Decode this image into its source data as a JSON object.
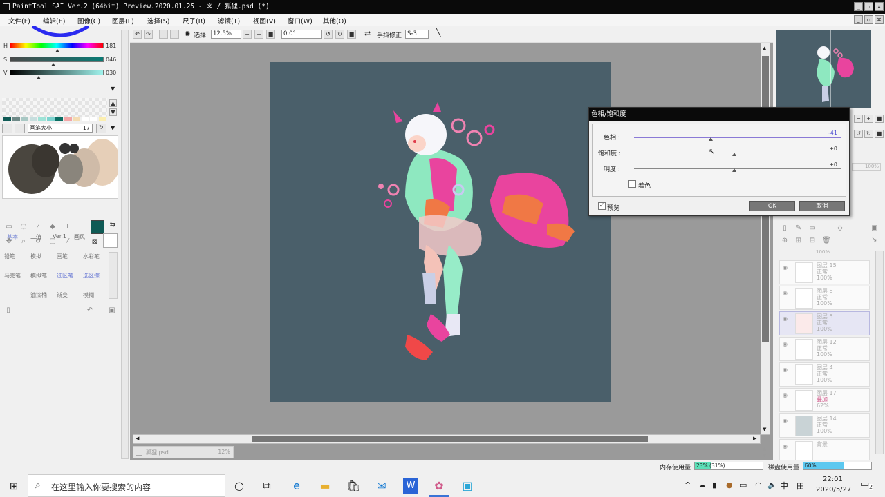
{
  "window": {
    "title": "PaintTool SAI Ver.2 (64bit) Preview.2020.01.25 - 図 / 狐狸.psd (*)",
    "controls": [
      "_",
      "▫",
      "✕"
    ]
  },
  "menu": [
    "文件(F)",
    "编辑(E)",
    "图像(C)",
    "图层(L)",
    "选择(S)",
    "尺子(R)",
    "滤镜(T)",
    "视图(V)",
    "窗口(W)",
    "其他(O)"
  ],
  "color_panel": {
    "h_label": "H",
    "h_value": "181",
    "s_label": "S",
    "s_value": "046",
    "v_label": "V",
    "v_value": "030",
    "swatches": [
      "#0f5a55",
      "#6f8a88",
      "#a9c8c4",
      "#c7dede",
      "#9fe3d7",
      "#7dd3cf",
      "#0c6d62",
      "#f2a6a6",
      "#f4dcb2",
      "#ffffff",
      "#ffffff",
      "#fbeeb0"
    ]
  },
  "brush_panel": {
    "size_label": "画笔大小",
    "size_value": "17",
    "tabs": [
      "基本",
      "二值",
      "Ver.1",
      "画风"
    ],
    "brushes": [
      "铅笔",
      "模拟",
      "画笔",
      "水彩笔",
      "马克笔",
      "模拟笔",
      "选区笔",
      "选区擦",
      "油漆桶",
      "渐变",
      "模糊"
    ],
    "primary_color": "#0f5a55"
  },
  "toolbar": {
    "select_label": "选择",
    "zoom": "12.5%",
    "angle": "0.0°",
    "stabilizer_label": "手抖修正",
    "stabilizer_value": "S-3"
  },
  "doc_tab": {
    "name": "狐狸.psd",
    "zoom": "12%"
  },
  "layers": [
    {
      "name": "图层 15",
      "mode": "正常",
      "opacity": "100%"
    },
    {
      "name": "图层 8",
      "mode": "正常",
      "opacity": "100%"
    },
    {
      "name": "图层 5",
      "mode": "正常",
      "opacity": "100%"
    },
    {
      "name": "图层 12",
      "mode": "正常",
      "opacity": "100%"
    },
    {
      "name": "图层 4",
      "mode": "正常",
      "opacity": "100%"
    },
    {
      "name": "图层 17",
      "mode": "叠加",
      "opacity": "62%"
    },
    {
      "name": "图层 14",
      "mode": "正常",
      "opacity": "100%"
    },
    {
      "name": "背景",
      "mode": "",
      "opacity": ""
    }
  ],
  "layer_top_partial": "100%",
  "right_misc": {
    "opacity": "100%"
  },
  "dialog": {
    "title": "色相/饱和度",
    "hue_label": "色相 :",
    "hue_value": "-41",
    "sat_label": "饱和度 :",
    "sat_value": "+0",
    "light_label": "明度 :",
    "light_value": "+0",
    "colorize_label": "着色",
    "preview_label": "预览",
    "ok_label": "OK",
    "cancel_label": "取消"
  },
  "status": {
    "mem_label": "内存使用量",
    "mem_value": "23% (31%)",
    "disk_label": "磁盘使用量",
    "disk_value": "60%"
  },
  "taskbar": {
    "search_placeholder": "在这里输入你要搜索的内容",
    "time": "22:01",
    "date": "2020/5/27",
    "ime": "中",
    "notifications": "2"
  }
}
